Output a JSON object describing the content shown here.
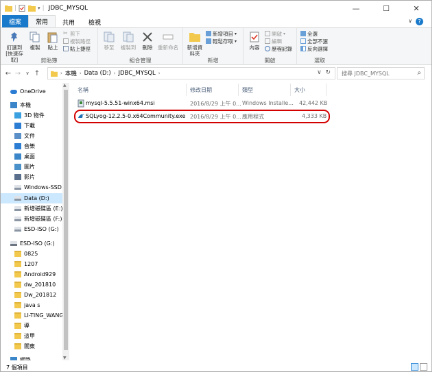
{
  "window": {
    "title": "JDBC_MYSQL",
    "controls": {
      "minimize": "—",
      "maximize": "☐",
      "close": "✕"
    }
  },
  "ribbon_tabs": {
    "file": "檔案",
    "home": "常用",
    "share": "共用",
    "view": "檢視"
  },
  "ribbon": {
    "clipboard": {
      "pin": "釘選到 [快速存取]",
      "copy": "複製",
      "paste": "貼上",
      "cut": "剪下",
      "copy_path": "複製路徑",
      "paste_shortcut": "貼上捷徑",
      "name": "剪貼簿"
    },
    "organize": {
      "move_to": "移至",
      "copy_to": "複製到",
      "delete": "刪除",
      "rename": "重新命名",
      "name": "組合管理"
    },
    "new": {
      "new_folder": "新增資料夾",
      "new_item": "新增項目",
      "easy_access": "輕鬆存取",
      "name": "新增"
    },
    "open": {
      "properties": "內容",
      "open": "開啟",
      "edit": "編輯",
      "history": "歷程記錄",
      "name": "開啟"
    },
    "select": {
      "select_all": "全選",
      "select_none": "全部不選",
      "invert": "反向選擇",
      "name": "選取"
    }
  },
  "address": {
    "crumbs": [
      "本機",
      "Data (D:)",
      "JDBC_MYSQL"
    ],
    "search_placeholder": "搜尋 JDBC_MYSQL"
  },
  "nav": [
    {
      "label": "OneDrive",
      "icon": "cloud-icon"
    },
    {
      "label": "本機",
      "icon": "pc-icon"
    },
    {
      "label": "3D 物件",
      "icon": "cube-icon"
    },
    {
      "label": "下載",
      "icon": "download-icon"
    },
    {
      "label": "文件",
      "icon": "document-icon"
    },
    {
      "label": "音樂",
      "icon": "music-icon"
    },
    {
      "label": "桌面",
      "icon": "desktop-icon"
    },
    {
      "label": "圖片",
      "icon": "picture-icon"
    },
    {
      "label": "影片",
      "icon": "video-icon"
    },
    {
      "label": "Windows-SSD (",
      "icon": "drive-icon"
    },
    {
      "label": "Data (D:)",
      "icon": "drive-icon"
    },
    {
      "label": "新增磁碟區 (E:)",
      "icon": "drive-icon"
    },
    {
      "label": "新增磁碟區 (F:)",
      "icon": "drive-icon"
    },
    {
      "label": "ESD-ISO (G:)",
      "icon": "drive-icon"
    },
    {
      "label": "ESD-ISO (G:)",
      "icon": "usb-drive-icon"
    },
    {
      "label": "0825",
      "icon": "folder-icon"
    },
    {
      "label": "1207",
      "icon": "folder-icon"
    },
    {
      "label": "Android929",
      "icon": "folder-icon"
    },
    {
      "label": "dw_201810",
      "icon": "folder-icon"
    },
    {
      "label": "Dw_201812",
      "icon": "folder-icon"
    },
    {
      "label": "java s",
      "icon": "folder-icon"
    },
    {
      "label": "LI-TING_WANG",
      "icon": "folder-icon"
    },
    {
      "label": "導",
      "icon": "folder-icon"
    },
    {
      "label": "這甲",
      "icon": "folder-icon"
    },
    {
      "label": "闇東",
      "icon": "folder-icon"
    },
    {
      "label": "網路",
      "icon": "network-icon"
    }
  ],
  "columns": {
    "name": "名稱",
    "date": "修改日期",
    "type": "類型",
    "size": "大小"
  },
  "files": [
    {
      "name": "mysql-5.5.51-winx64.msi",
      "date": "2016/8/29 上午 0...",
      "type": "Windows Installe...",
      "size": "42,442 KB"
    },
    {
      "name": "SQLyog-12.2.5-0.x64Community.exe",
      "date": "2016/8/29 上午 0...",
      "type": "應用程式",
      "size": "4,333 KB"
    }
  ],
  "status": {
    "count": "7 個項目"
  },
  "colors": {
    "accent": "#1979ca",
    "highlight": "#d40000",
    "selection": "#cce8ff"
  }
}
